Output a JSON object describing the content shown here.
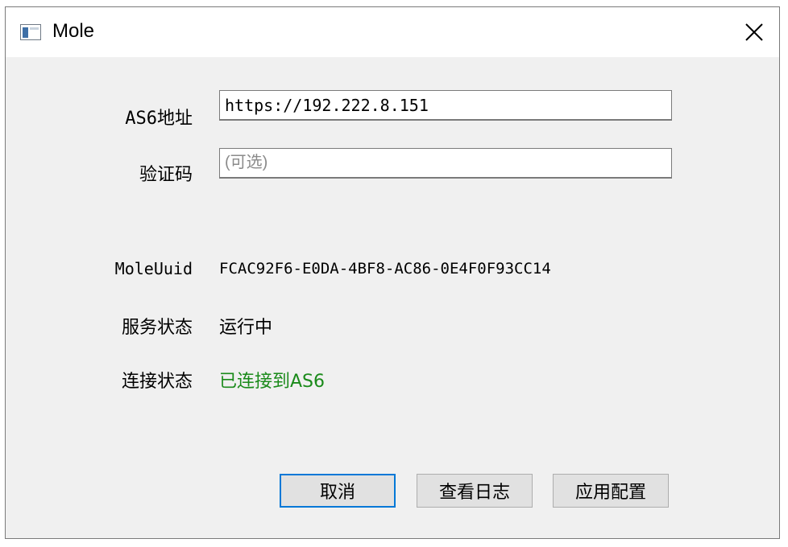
{
  "window": {
    "title": "Mole"
  },
  "form": {
    "address_label": "AS6地址",
    "address_value": "https://192.222.8.151",
    "code_label": "验证码",
    "code_placeholder": "(可选)",
    "uid_label": "MoleUuid",
    "uid_value": "FCAC92F6-E0DA-4BF8-AC86-0E4F0F93CC14",
    "service_label": "服务状态",
    "service_value": "运行中",
    "connection_label": "连接状态",
    "connection_value": "已连接到AS6",
    "connection_color": "#1a8a1a"
  },
  "buttons": {
    "cancel": "取消",
    "view_log": "查看日志",
    "apply": "应用配置",
    "accent": "#0078d7"
  },
  "icons": {
    "app": "app-window-icon",
    "close": "close-icon"
  }
}
